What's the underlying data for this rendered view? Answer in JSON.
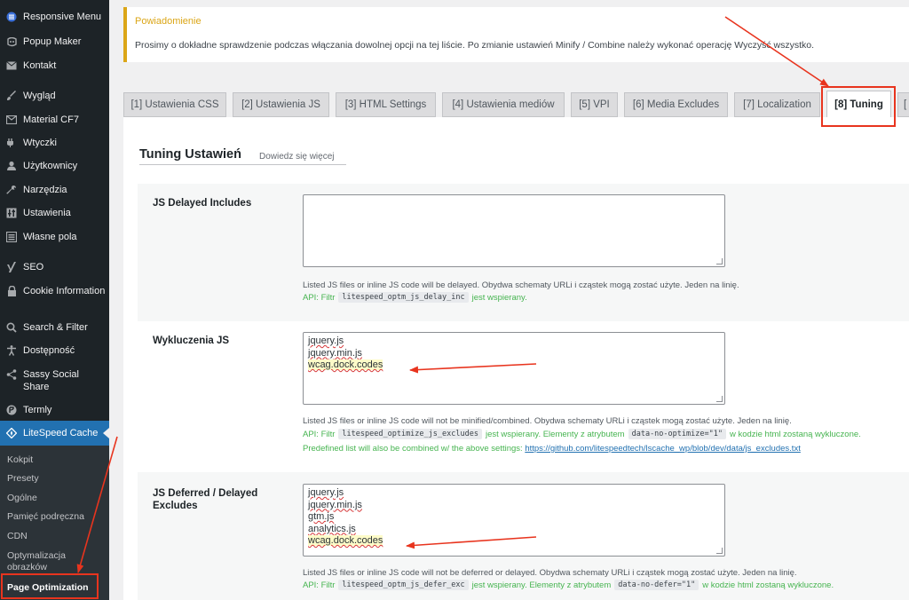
{
  "sidebar": {
    "items": [
      {
        "label": "Responsive Menu",
        "icon": "responsive-menu-icon"
      },
      {
        "label": "Popup Maker",
        "icon": "popup-maker-icon"
      },
      {
        "label": "Kontakt",
        "icon": "mail-icon"
      },
      {
        "label": "Wygląd",
        "icon": "appearance-brush-icon"
      },
      {
        "label": "Material CF7",
        "icon": "envelope-icon"
      },
      {
        "label": "Wtyczki",
        "icon": "plugin-icon"
      },
      {
        "label": "Użytkownicy",
        "icon": "users-icon"
      },
      {
        "label": "Narzędzia",
        "icon": "tools-wrench-icon"
      },
      {
        "label": "Ustawienia",
        "icon": "settings-icon"
      },
      {
        "label": "Własne pola",
        "icon": "custom-fields-icon"
      },
      {
        "label": "SEO",
        "icon": "yoast-seo-icon"
      },
      {
        "label": "Cookie Information",
        "icon": "lock-icon"
      },
      {
        "label": "Search & Filter",
        "icon": "search-icon"
      },
      {
        "label": "Dostępność",
        "icon": "accessibility-icon"
      },
      {
        "label": "Sassy Social Share",
        "icon": "share-icon"
      },
      {
        "label": "Termly",
        "icon": "termly-icon"
      },
      {
        "label": "LiteSpeed Cache",
        "icon": "litespeed-diamond-icon"
      }
    ],
    "submenu": [
      {
        "label": "Kokpit"
      },
      {
        "label": "Presety"
      },
      {
        "label": "Ogólne"
      },
      {
        "label": "Pamięć podręczna"
      },
      {
        "label": "CDN"
      },
      {
        "label": "Optymalizacja obrazków"
      },
      {
        "label": "Page Optimization"
      }
    ]
  },
  "notice": {
    "title": "Powiadomienie",
    "text": "Prosimy o dokładne sprawdzenie podczas włączania dowolnej opcji na tej liście. Po zmianie ustawień Minify / Combine należy wykonać operację Wyczyść wszystko."
  },
  "tabs": [
    {
      "label": "[1] Ustawienia CSS"
    },
    {
      "label": "[2] Ustawienia JS"
    },
    {
      "label": "[3] HTML Settings"
    },
    {
      "label": "[4] Ustawienia mediów"
    },
    {
      "label": "[5] VPI"
    },
    {
      "label": "[6] Media Excludes"
    },
    {
      "label": "[7] Localization"
    },
    {
      "label": "[8] Tuning",
      "active": true
    },
    {
      "label": "["
    }
  ],
  "section": {
    "title": "Tuning Ustawień",
    "learn_more": "Dowiedz się więcej"
  },
  "settings": {
    "js_delayed": {
      "label": "JS Delayed Includes",
      "value": [],
      "desc": "Listed JS files or inline JS code will be delayed. Obydwa schematy URLi i cząstek mogą zostać użyte. Jeden na linię.",
      "api_prefix": "API: Filtr",
      "api_code": "litespeed_optm_js_delay_inc",
      "api_suffix": "jest wspierany."
    },
    "js_excludes": {
      "label": "Wykluczenia JS",
      "value": [
        "jquery.js",
        "jquery.min.js",
        "wcag.dock.codes"
      ],
      "desc": "Listed JS files or inline JS code will not be minified/combined. Obydwa schematy URLi i cząstek mogą zostać użyte. Jeden na linię.",
      "api_prefix": "API: Filtr",
      "api_code": "litespeed_optimize_js_excludes",
      "api_middle": "jest wspierany. Elementy z atrybutem",
      "api_code2": "data-no-optimize=\"1\"",
      "api_suffix": "w kodzie html zostaną wykluczone.",
      "predef_text": "Predefined list will also be combined w/ the above settings:",
      "predef_link": "https://github.com/litespeedtech/lscache_wp/blob/dev/data/js_excludes.txt"
    },
    "js_deferred": {
      "label": "JS Deferred / Delayed Excludes",
      "value": [
        "jquery.js",
        "jquery.min.js",
        "gtm.js",
        "analytics.js",
        "wcag.dock.codes"
      ],
      "desc": "Listed JS files or inline JS code will not be deferred or delayed. Obydwa schematy URLi i cząstek mogą zostać użyte. Jeden na linię.",
      "api_prefix": "API: Filtr",
      "api_code": "litespeed_optm_js_defer_exc",
      "api_middle": "jest wspierany. Elementy z atrybutem",
      "api_code2": "data-no-defer=\"1\"",
      "api_suffix": "w kodzie html zostaną wykluczone."
    }
  },
  "colors": {
    "sidebar_bg": "#1d2327",
    "accent": "#2271b1",
    "notice_border": "#dba617",
    "annotation": "#e8341e",
    "api_green": "#46b450"
  }
}
